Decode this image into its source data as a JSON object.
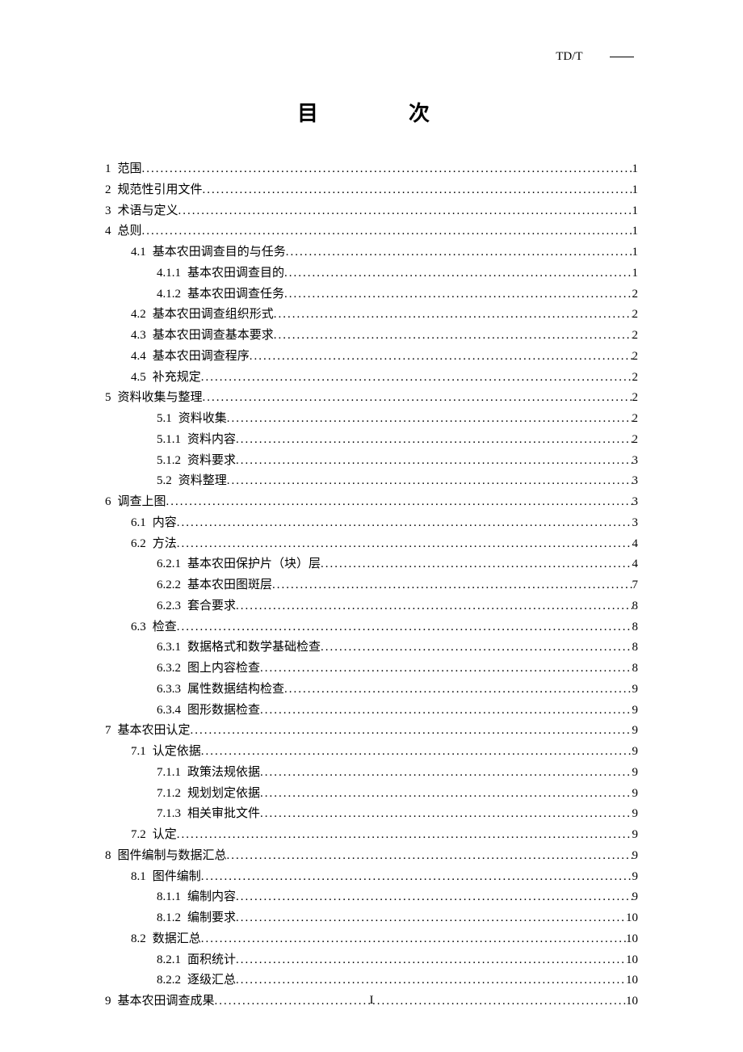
{
  "header_code": "TD/T",
  "title": "目　　次",
  "page_number": "I",
  "toc": [
    {
      "indent": 0,
      "num": "1",
      "text": "范围",
      "page": "1"
    },
    {
      "indent": 0,
      "num": "2",
      "text": "规范性引用文件",
      "page": "1"
    },
    {
      "indent": 0,
      "num": "3",
      "text": "术语与定义",
      "page": "1"
    },
    {
      "indent": 0,
      "num": "4",
      "text": "总则",
      "page": "1"
    },
    {
      "indent": 1,
      "num": "4.1",
      "text": "基本农田调查目的与任务",
      "page": "1"
    },
    {
      "indent": 2,
      "num": "4.1.1",
      "text": "基本农田调查目的",
      "page": "1"
    },
    {
      "indent": 2,
      "num": "4.1.2",
      "text": "基本农田调查任务",
      "page": "2"
    },
    {
      "indent": 1,
      "num": "4.2",
      "text": "基本农田调查组织形式",
      "page": "2"
    },
    {
      "indent": 1,
      "num": "4.3",
      "text": "基本农田调查基本要求",
      "page": "2"
    },
    {
      "indent": 1,
      "num": "4.4",
      "text": "基本农田调查程序",
      "page": "2"
    },
    {
      "indent": 1,
      "num": "4.5",
      "text": "补充规定",
      "page": "2"
    },
    {
      "indent": 0,
      "num": "5",
      "text": "资料收集与整理",
      "page": "2"
    },
    {
      "indent": 2,
      "num": "5.1",
      "text": "资料收集",
      "page": "2"
    },
    {
      "indent": 2,
      "num": "5.1.1",
      "text": "资料内容",
      "page": "2"
    },
    {
      "indent": 2,
      "num": "5.1.2",
      "text": "资料要求",
      "page": "3"
    },
    {
      "indent": 2,
      "num": "5.2",
      "text": "资料整理",
      "page": "3"
    },
    {
      "indent": 0,
      "num": "6",
      "text": "调查上图",
      "page": "3"
    },
    {
      "indent": 1,
      "num": "6.1",
      "text": "内容",
      "page": "3"
    },
    {
      "indent": 1,
      "num": "6.2",
      "text": "方法",
      "page": "4"
    },
    {
      "indent": 2,
      "num": "6.2.1",
      "text": "基本农田保护片（块）层",
      "page": "4"
    },
    {
      "indent": 2,
      "num": "6.2.2",
      "text": "基本农田图斑层",
      "page": "7"
    },
    {
      "indent": 2,
      "num": "6.2.3",
      "text": "套合要求",
      "page": "8"
    },
    {
      "indent": 1,
      "num": "6.3",
      "text": "检查",
      "page": "8"
    },
    {
      "indent": 2,
      "num": "6.3.1",
      "text": "数据格式和数学基础检查",
      "page": "8"
    },
    {
      "indent": 2,
      "num": "6.3.2",
      "text": "图上内容检查",
      "page": "8"
    },
    {
      "indent": 2,
      "num": "6.3.3",
      "text": "属性数据结构检查",
      "page": "9"
    },
    {
      "indent": 2,
      "num": "6.3.4",
      "text": "图形数据检查",
      "page": "9"
    },
    {
      "indent": 0,
      "num": "7",
      "text": "基本农田认定",
      "page": "9"
    },
    {
      "indent": 1,
      "num": "7.1",
      "text": "认定依据",
      "page": "9"
    },
    {
      "indent": 2,
      "num": "7.1.1",
      "text": "政策法规依据",
      "page": "9"
    },
    {
      "indent": 2,
      "num": "7.1.2",
      "text": "规划划定依据",
      "page": "9"
    },
    {
      "indent": 2,
      "num": "7.1.3",
      "text": "相关审批文件",
      "page": "9"
    },
    {
      "indent": 1,
      "num": "7.2",
      "text": "认定",
      "page": "9"
    },
    {
      "indent": 0,
      "num": "8",
      "text": "图件编制与数据汇总",
      "page": "9"
    },
    {
      "indent": 1,
      "num": "8.1",
      "text": "图件编制",
      "page": "9"
    },
    {
      "indent": 2,
      "num": "8.1.1",
      "text": "编制内容",
      "page": "9"
    },
    {
      "indent": 2,
      "num": "8.1.2",
      "text": "编制要求",
      "page": "10"
    },
    {
      "indent": 1,
      "num": "8.2",
      "text": "数据汇总",
      "page": "10"
    },
    {
      "indent": 2,
      "num": "8.2.1",
      "text": "面积统计",
      "page": "10"
    },
    {
      "indent": 2,
      "num": "8.2.2",
      "text": "逐级汇总",
      "page": "10"
    },
    {
      "indent": 0,
      "num": "9",
      "text": "基本农田调查成果",
      "page": "10"
    }
  ]
}
